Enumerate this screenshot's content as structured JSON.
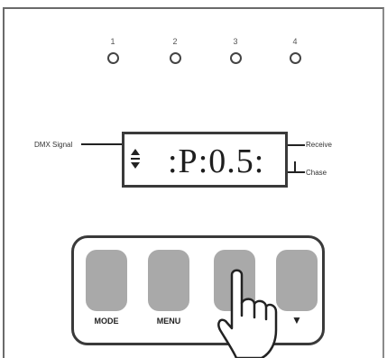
{
  "channels": [
    "1",
    "2",
    "3",
    "4"
  ],
  "display": {
    "readout": ":P:0.5:",
    "left_label": "DMX Signal",
    "right_labels": [
      "Receive",
      "Chase"
    ]
  },
  "keypad": {
    "keys": [
      "MODE",
      "MENU",
      "",
      "▼"
    ],
    "pressed_key_index": 2
  },
  "icons": [
    "led-indicator-icon",
    "pointing-hand-icon",
    "down-arrow-icon"
  ],
  "colors": {
    "line": "#3a3a3a",
    "key_fill": "#a9a9a9",
    "background": "#ffffff"
  }
}
